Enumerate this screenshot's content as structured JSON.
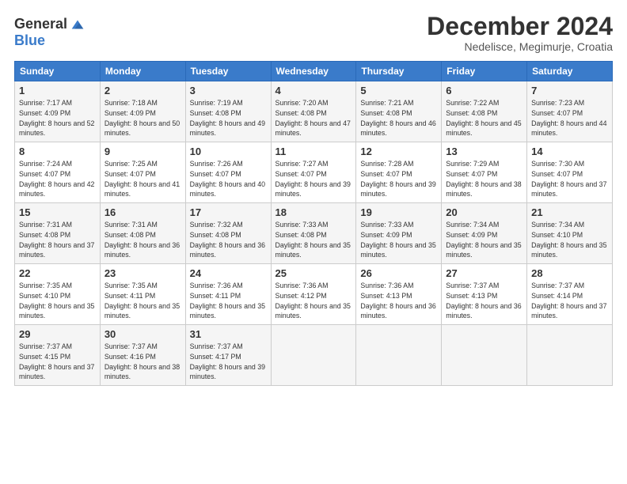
{
  "header": {
    "logo": {
      "line1": "General",
      "line2": "Blue"
    },
    "title": "December 2024",
    "subtitle": "Nedelisce, Megimurje, Croatia"
  },
  "weekdays": [
    "Sunday",
    "Monday",
    "Tuesday",
    "Wednesday",
    "Thursday",
    "Friday",
    "Saturday"
  ],
  "weeks": [
    [
      {
        "day": "1",
        "sunrise": "7:17 AM",
        "sunset": "4:09 PM",
        "daylight": "8 hours and 52 minutes."
      },
      {
        "day": "2",
        "sunrise": "7:18 AM",
        "sunset": "4:09 PM",
        "daylight": "8 hours and 50 minutes."
      },
      {
        "day": "3",
        "sunrise": "7:19 AM",
        "sunset": "4:08 PM",
        "daylight": "8 hours and 49 minutes."
      },
      {
        "day": "4",
        "sunrise": "7:20 AM",
        "sunset": "4:08 PM",
        "daylight": "8 hours and 47 minutes."
      },
      {
        "day": "5",
        "sunrise": "7:21 AM",
        "sunset": "4:08 PM",
        "daylight": "8 hours and 46 minutes."
      },
      {
        "day": "6",
        "sunrise": "7:22 AM",
        "sunset": "4:08 PM",
        "daylight": "8 hours and 45 minutes."
      },
      {
        "day": "7",
        "sunrise": "7:23 AM",
        "sunset": "4:07 PM",
        "daylight": "8 hours and 44 minutes."
      }
    ],
    [
      {
        "day": "8",
        "sunrise": "7:24 AM",
        "sunset": "4:07 PM",
        "daylight": "8 hours and 42 minutes."
      },
      {
        "day": "9",
        "sunrise": "7:25 AM",
        "sunset": "4:07 PM",
        "daylight": "8 hours and 41 minutes."
      },
      {
        "day": "10",
        "sunrise": "7:26 AM",
        "sunset": "4:07 PM",
        "daylight": "8 hours and 40 minutes."
      },
      {
        "day": "11",
        "sunrise": "7:27 AM",
        "sunset": "4:07 PM",
        "daylight": "8 hours and 39 minutes."
      },
      {
        "day": "12",
        "sunrise": "7:28 AM",
        "sunset": "4:07 PM",
        "daylight": "8 hours and 39 minutes."
      },
      {
        "day": "13",
        "sunrise": "7:29 AM",
        "sunset": "4:07 PM",
        "daylight": "8 hours and 38 minutes."
      },
      {
        "day": "14",
        "sunrise": "7:30 AM",
        "sunset": "4:07 PM",
        "daylight": "8 hours and 37 minutes."
      }
    ],
    [
      {
        "day": "15",
        "sunrise": "7:31 AM",
        "sunset": "4:08 PM",
        "daylight": "8 hours and 37 minutes."
      },
      {
        "day": "16",
        "sunrise": "7:31 AM",
        "sunset": "4:08 PM",
        "daylight": "8 hours and 36 minutes."
      },
      {
        "day": "17",
        "sunrise": "7:32 AM",
        "sunset": "4:08 PM",
        "daylight": "8 hours and 36 minutes."
      },
      {
        "day": "18",
        "sunrise": "7:33 AM",
        "sunset": "4:08 PM",
        "daylight": "8 hours and 35 minutes."
      },
      {
        "day": "19",
        "sunrise": "7:33 AM",
        "sunset": "4:09 PM",
        "daylight": "8 hours and 35 minutes."
      },
      {
        "day": "20",
        "sunrise": "7:34 AM",
        "sunset": "4:09 PM",
        "daylight": "8 hours and 35 minutes."
      },
      {
        "day": "21",
        "sunrise": "7:34 AM",
        "sunset": "4:10 PM",
        "daylight": "8 hours and 35 minutes."
      }
    ],
    [
      {
        "day": "22",
        "sunrise": "7:35 AM",
        "sunset": "4:10 PM",
        "daylight": "8 hours and 35 minutes."
      },
      {
        "day": "23",
        "sunrise": "7:35 AM",
        "sunset": "4:11 PM",
        "daylight": "8 hours and 35 minutes."
      },
      {
        "day": "24",
        "sunrise": "7:36 AM",
        "sunset": "4:11 PM",
        "daylight": "8 hours and 35 minutes."
      },
      {
        "day": "25",
        "sunrise": "7:36 AM",
        "sunset": "4:12 PM",
        "daylight": "8 hours and 35 minutes."
      },
      {
        "day": "26",
        "sunrise": "7:36 AM",
        "sunset": "4:13 PM",
        "daylight": "8 hours and 36 minutes."
      },
      {
        "day": "27",
        "sunrise": "7:37 AM",
        "sunset": "4:13 PM",
        "daylight": "8 hours and 36 minutes."
      },
      {
        "day": "28",
        "sunrise": "7:37 AM",
        "sunset": "4:14 PM",
        "daylight": "8 hours and 37 minutes."
      }
    ],
    [
      {
        "day": "29",
        "sunrise": "7:37 AM",
        "sunset": "4:15 PM",
        "daylight": "8 hours and 37 minutes."
      },
      {
        "day": "30",
        "sunrise": "7:37 AM",
        "sunset": "4:16 PM",
        "daylight": "8 hours and 38 minutes."
      },
      {
        "day": "31",
        "sunrise": "7:37 AM",
        "sunset": "4:17 PM",
        "daylight": "8 hours and 39 minutes."
      },
      null,
      null,
      null,
      null
    ]
  ]
}
